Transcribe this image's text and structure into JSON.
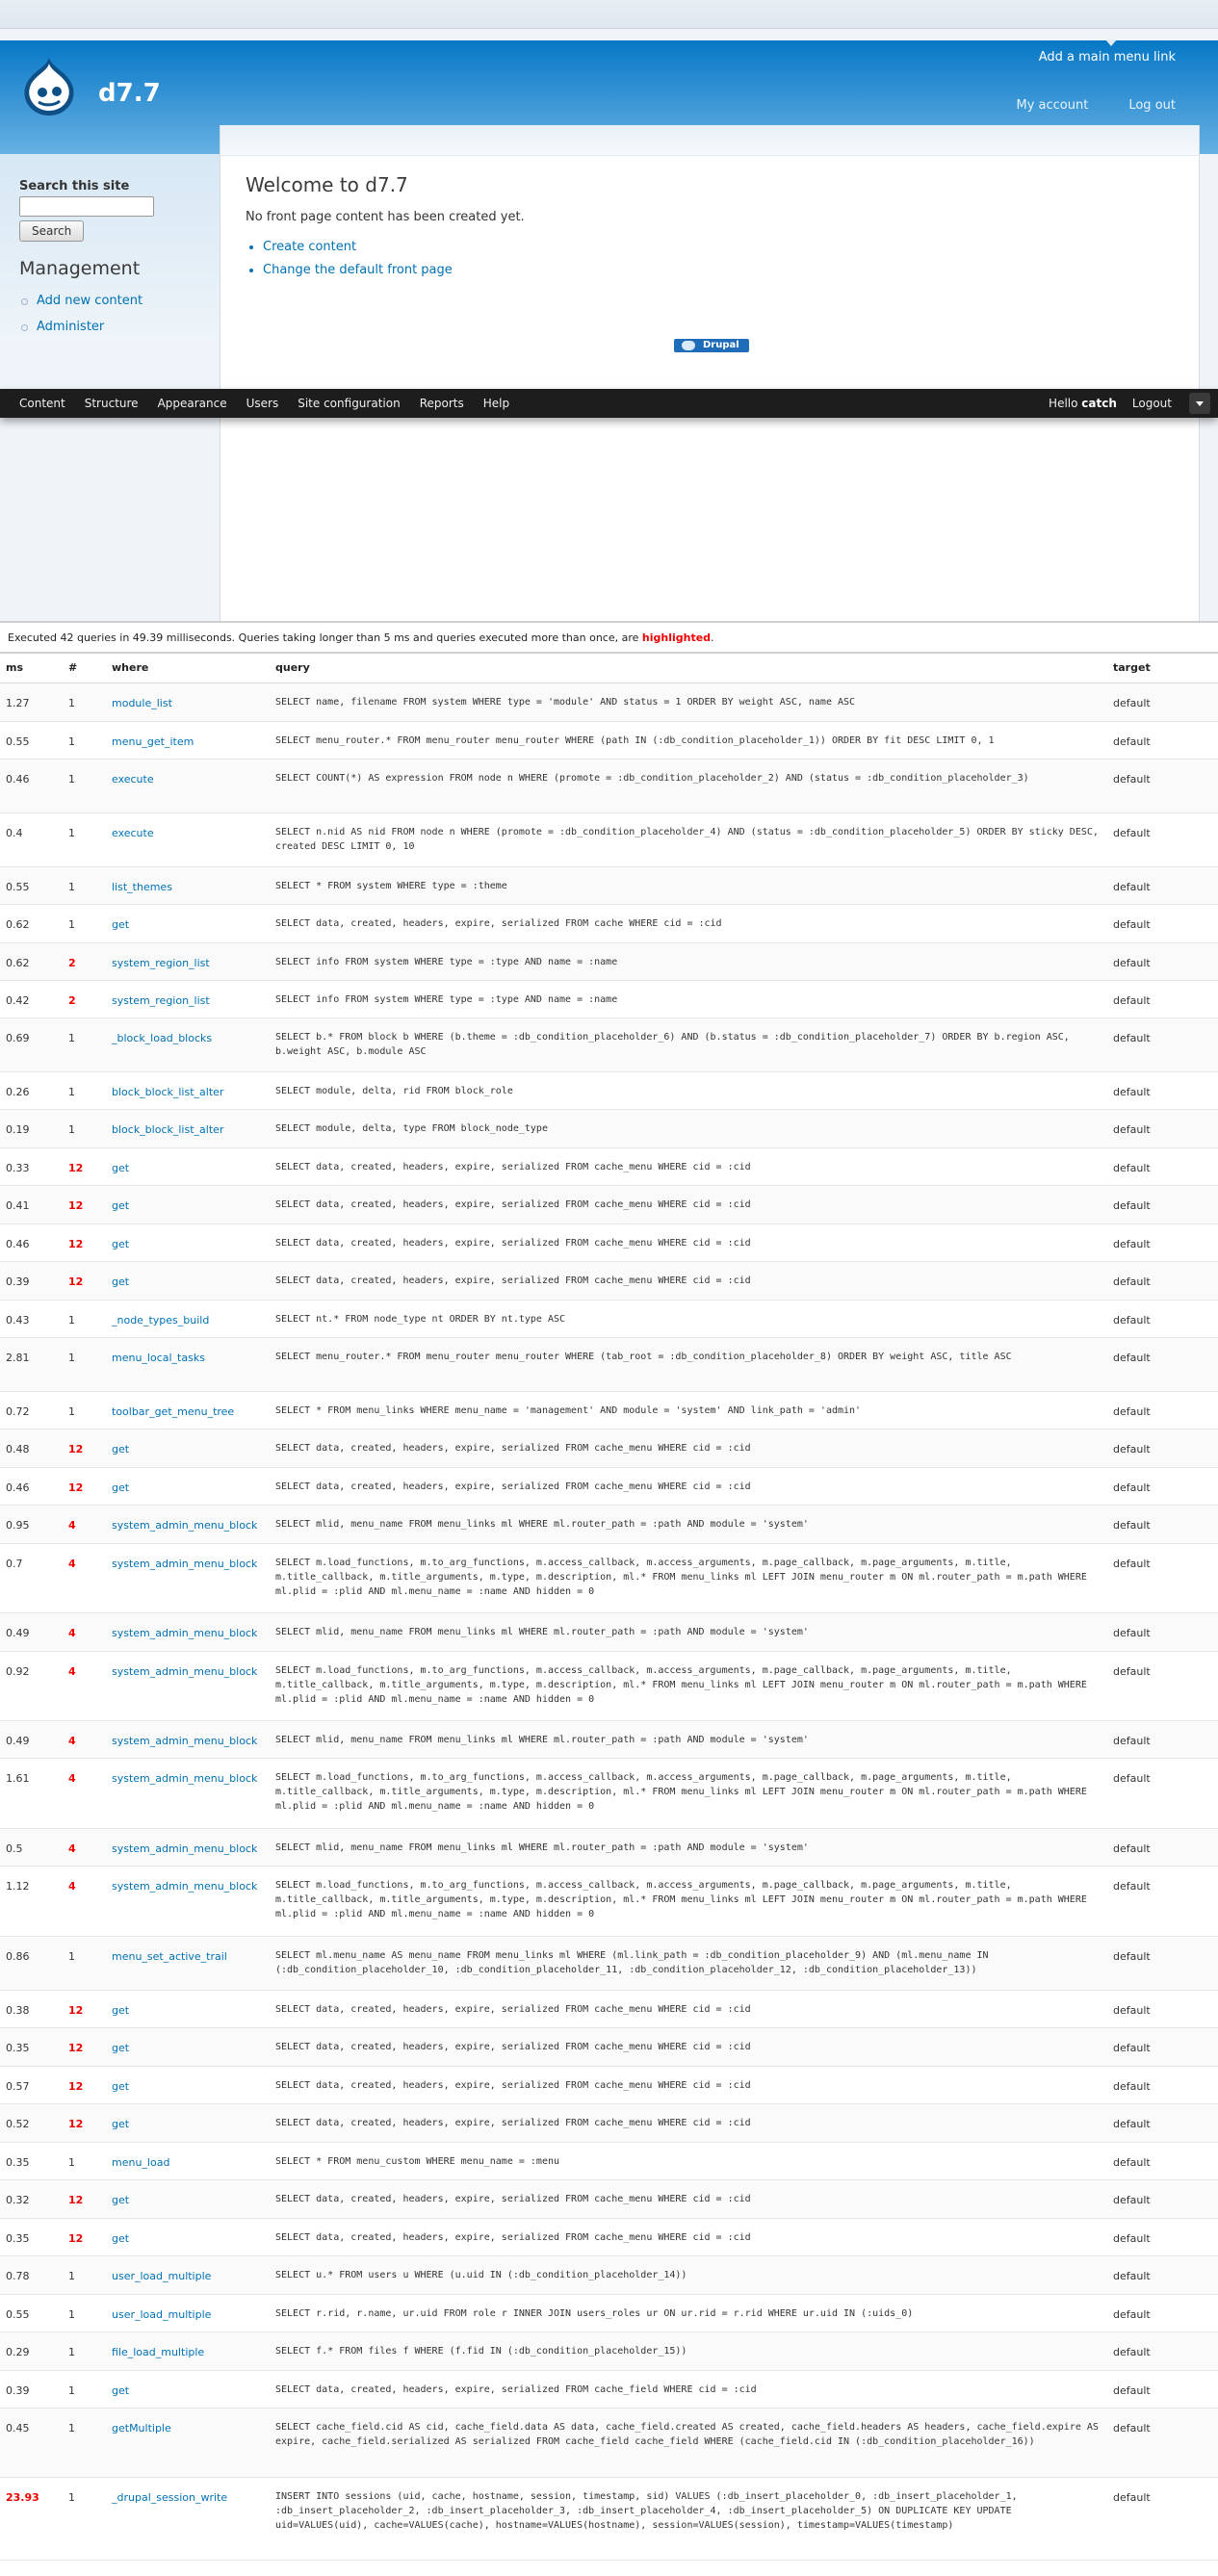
{
  "site": {
    "name": "d7.7",
    "main_menu_link": "Add a main menu link",
    "secondary_menu": [
      "My account",
      "Log out"
    ]
  },
  "sidebar": {
    "search_title": "Search this site",
    "search_value": "",
    "search_button": "Search",
    "management_title": "Management",
    "management_items": [
      "Add new content",
      "Administer"
    ]
  },
  "main": {
    "title": "Welcome to d7.7",
    "message": "No front page content has been created yet.",
    "links": [
      "Create content",
      "Change the default front page"
    ],
    "powered_by": "Drupal"
  },
  "toolbar": {
    "items": [
      "Content",
      "Structure",
      "Appearance",
      "Users",
      "Site configuration",
      "Reports",
      "Help"
    ],
    "hello_prefix": "Hello",
    "user": "catch",
    "logout": "Logout"
  },
  "devel": {
    "summary_prefix": "Executed 42 queries in 49.39 milliseconds. Queries taking longer than 5 ms and queries executed more than once, are",
    "summary_highlight": "highlighted",
    "summary_suffix": ".",
    "columns": [
      "ms",
      "#",
      "where",
      "query",
      "target"
    ],
    "rows": [
      {
        "ms": "1.27",
        "n": "1",
        "where": "module_list",
        "query": "SELECT name, filename FROM system WHERE type = 'module' AND status = 1 ORDER BY weight ASC, name ASC",
        "target": "default",
        "h": 40
      },
      {
        "ms": "0.55",
        "n": "1",
        "where": "menu_get_item",
        "query": "SELECT menu_router.* FROM menu_router menu_router WHERE (path IN (:db_condition_placeholder_1)) ORDER BY fit DESC LIMIT 0, 1",
        "target": "default",
        "h": 39
      },
      {
        "ms": "0.46",
        "n": "1",
        "where": "execute",
        "query": "SELECT COUNT(*) AS expression FROM node n WHERE (promote = :db_condition_placeholder_2) AND (status = :db_condition_placeholder_3)",
        "target": "default",
        "h": 56
      },
      {
        "ms": "0.4",
        "n": "1",
        "where": "execute",
        "query": "SELECT n.nid AS nid FROM node n WHERE (promote = :db_condition_placeholder_4) AND (status = :db_condition_placeholder_5) ORDER BY sticky DESC, created DESC LIMIT 0, 10",
        "target": "default",
        "h": 56
      },
      {
        "ms": "0.55",
        "n": "1",
        "where": "list_themes",
        "query": "SELECT * FROM system WHERE type = :theme",
        "target": "default",
        "h": 39
      },
      {
        "ms": "0.62",
        "n": "1",
        "where": "get",
        "query": "SELECT data, created, headers, expire, serialized FROM cache WHERE cid = :cid",
        "target": "default",
        "h": 40
      },
      {
        "ms": "0.62",
        "n": "2",
        "where": "system_region_list",
        "query": "SELECT info FROM system WHERE type = :type AND name = :name",
        "target": "default",
        "h": 39
      },
      {
        "ms": "0.42",
        "n": "2",
        "where": "system_region_list",
        "query": "SELECT info FROM system WHERE type = :type AND name = :name",
        "target": "default",
        "h": 39
      },
      {
        "ms": "0.69",
        "n": "1",
        "where": "_block_load_blocks",
        "query": "SELECT b.* FROM block b WHERE (b.theme = :db_condition_placeholder_6) AND (b.status = :db_condition_placeholder_7) ORDER BY b.region ASC, b.weight ASC, b.module ASC",
        "target": "default",
        "h": 56
      },
      {
        "ms": "0.26",
        "n": "1",
        "where": "block_block_list_alter",
        "query": "SELECT module, delta, rid FROM block_role",
        "target": "default",
        "h": 39
      },
      {
        "ms": "0.19",
        "n": "1",
        "where": "block_block_list_alter",
        "query": "SELECT module, delta, type FROM block_node_type",
        "target": "default",
        "h": 40
      },
      {
        "ms": "0.33",
        "n": "12",
        "where": "get",
        "query": "SELECT data, created, headers, expire, serialized FROM cache_menu WHERE cid = :cid",
        "target": "default",
        "h": 39
      },
      {
        "ms": "0.41",
        "n": "12",
        "where": "get",
        "query": "SELECT data, created, headers, expire, serialized FROM cache_menu WHERE cid = :cid",
        "target": "default",
        "h": 40
      },
      {
        "ms": "0.46",
        "n": "12",
        "where": "get",
        "query": "SELECT data, created, headers, expire, serialized FROM cache_menu WHERE cid = :cid",
        "target": "default",
        "h": 39
      },
      {
        "ms": "0.39",
        "n": "12",
        "where": "get",
        "query": "SELECT data, created, headers, expire, serialized FROM cache_menu WHERE cid = :cid",
        "target": "default",
        "h": 40
      },
      {
        "ms": "0.43",
        "n": "1",
        "where": "_node_types_build",
        "query": "SELECT nt.* FROM node_type nt ORDER BY nt.type ASC",
        "target": "default",
        "h": 39
      },
      {
        "ms": "2.81",
        "n": "1",
        "where": "menu_local_tasks",
        "query": "SELECT menu_router.* FROM menu_router menu_router WHERE (tab_root = :db_condition_placeholder_8) ORDER BY weight ASC, title ASC",
        "target": "default",
        "h": 56
      },
      {
        "ms": "0.72",
        "n": "1",
        "where": "toolbar_get_menu_tree",
        "query": "SELECT * FROM menu_links WHERE menu_name = 'management' AND module = 'system' AND link_path = 'admin'",
        "target": "default",
        "h": 39
      },
      {
        "ms": "0.48",
        "n": "12",
        "where": "get",
        "query": "SELECT data, created, headers, expire, serialized FROM cache_menu WHERE cid = :cid",
        "target": "default",
        "h": 40
      },
      {
        "ms": "0.46",
        "n": "12",
        "where": "get",
        "query": "SELECT data, created, headers, expire, serialized FROM cache_menu WHERE cid = :cid",
        "target": "default",
        "h": 39
      },
      {
        "ms": "0.95",
        "n": "4",
        "where": "system_admin_menu_block",
        "query": "SELECT mlid, menu_name FROM menu_links ml WHERE ml.router_path = :path AND module = 'system'",
        "target": "default",
        "h": 40
      },
      {
        "ms": "0.7",
        "n": "4",
        "where": "system_admin_menu_block",
        "query": "SELECT m.load_functions, m.to_arg_functions, m.access_callback, m.access_arguments, m.page_callback, m.page_arguments, m.title, m.title_callback, m.title_arguments, m.type, m.description, ml.* FROM menu_links ml LEFT JOIN menu_router m ON ml.router_path = m.path WHERE ml.plid = :plid AND ml.menu_name = :name AND hidden = 0",
        "target": "default",
        "h": 72
      },
      {
        "ms": "0.49",
        "n": "4",
        "where": "system_admin_menu_block",
        "query": "SELECT mlid, menu_name FROM menu_links ml WHERE ml.router_path = :path AND module = 'system'",
        "target": "default",
        "h": 40
      },
      {
        "ms": "0.92",
        "n": "4",
        "where": "system_admin_menu_block",
        "query": "SELECT m.load_functions, m.to_arg_functions, m.access_callback, m.access_arguments, m.page_callback, m.page_arguments, m.title, m.title_callback, m.title_arguments, m.type, m.description, ml.* FROM menu_links ml LEFT JOIN menu_router m ON ml.router_path = m.path WHERE ml.plid = :plid AND ml.menu_name = :name AND hidden = 0",
        "target": "default",
        "h": 72
      },
      {
        "ms": "0.49",
        "n": "4",
        "where": "system_admin_menu_block",
        "query": "SELECT mlid, menu_name FROM menu_links ml WHERE ml.router_path = :path AND module = 'system'",
        "target": "default",
        "h": 39
      },
      {
        "ms": "1.61",
        "n": "4",
        "where": "system_admin_menu_block",
        "query": "SELECT m.load_functions, m.to_arg_functions, m.access_callback, m.access_arguments, m.page_callback, m.page_arguments, m.title, m.title_callback, m.title_arguments, m.type, m.description, ml.* FROM menu_links ml LEFT JOIN menu_router m ON ml.router_path = m.path WHERE ml.plid = :plid AND ml.menu_name = :name AND hidden = 0",
        "target": "default",
        "h": 73
      },
      {
        "ms": "0.5",
        "n": "4",
        "where": "system_admin_menu_block",
        "query": "SELECT mlid, menu_name FROM menu_links ml WHERE ml.router_path = :path AND module = 'system'",
        "target": "default",
        "h": 39
      },
      {
        "ms": "1.12",
        "n": "4",
        "where": "system_admin_menu_block",
        "query": "SELECT m.load_functions, m.to_arg_functions, m.access_callback, m.access_arguments, m.page_callback, m.page_arguments, m.title, m.title_callback, m.title_arguments, m.type, m.description, ml.* FROM menu_links ml LEFT JOIN menu_router m ON ml.router_path = m.path WHERE ml.plid = :plid AND ml.menu_name = :name AND hidden = 0",
        "target": "default",
        "h": 73
      },
      {
        "ms": "0.86",
        "n": "1",
        "where": "menu_set_active_trail",
        "query": "SELECT ml.menu_name AS menu_name FROM menu_links ml WHERE (ml.link_path = :db_condition_placeholder_9) AND (ml.menu_name IN (:db_condition_placeholder_10, :db_condition_placeholder_11, :db_condition_placeholder_12, :db_condition_placeholder_13))",
        "target": "default",
        "h": 56
      },
      {
        "ms": "0.38",
        "n": "12",
        "where": "get",
        "query": "SELECT data, created, headers, expire, serialized FROM cache_menu WHERE cid = :cid",
        "target": "default",
        "h": 39
      },
      {
        "ms": "0.35",
        "n": "12",
        "where": "get",
        "query": "SELECT data, created, headers, expire, serialized FROM cache_menu WHERE cid = :cid",
        "target": "default",
        "h": 40
      },
      {
        "ms": "0.57",
        "n": "12",
        "where": "get",
        "query": "SELECT data, created, headers, expire, serialized FROM cache_menu WHERE cid = :cid",
        "target": "default",
        "h": 39
      },
      {
        "ms": "0.52",
        "n": "12",
        "where": "get",
        "query": "SELECT data, created, headers, expire, serialized FROM cache_menu WHERE cid = :cid",
        "target": "default",
        "h": 40
      },
      {
        "ms": "0.35",
        "n": "1",
        "where": "menu_load",
        "query": "SELECT * FROM menu_custom WHERE menu_name = :menu",
        "target": "default",
        "h": 39
      },
      {
        "ms": "0.32",
        "n": "12",
        "where": "get",
        "query": "SELECT data, created, headers, expire, serialized FROM cache_menu WHERE cid = :cid",
        "target": "default",
        "h": 40
      },
      {
        "ms": "0.35",
        "n": "12",
        "where": "get",
        "query": "SELECT data, created, headers, expire, serialized FROM cache_menu WHERE cid = :cid",
        "target": "default",
        "h": 39
      },
      {
        "ms": "0.78",
        "n": "1",
        "where": "user_load_multiple",
        "query": "SELECT u.* FROM users u WHERE (u.uid IN (:db_condition_placeholder_14))",
        "target": "default",
        "h": 40
      },
      {
        "ms": "0.55",
        "n": "1",
        "where": "user_load_multiple",
        "query": "SELECT r.rid, r.name, ur.uid FROM role r INNER JOIN users_roles ur ON ur.rid = r.rid WHERE ur.uid IN (:uids_0)",
        "target": "default",
        "h": 39
      },
      {
        "ms": "0.29",
        "n": "1",
        "where": "file_load_multiple",
        "query": "SELECT f.* FROM files f WHERE (f.fid IN (:db_condition_placeholder_15))",
        "target": "default",
        "h": 40
      },
      {
        "ms": "0.39",
        "n": "1",
        "where": "get",
        "query": "SELECT data, created, headers, expire, serialized FROM cache_field WHERE cid = :cid",
        "target": "default",
        "h": 39
      },
      {
        "ms": "0.45",
        "n": "1",
        "where": "getMultiple",
        "query": "SELECT cache_field.cid AS cid, cache_field.data AS data, cache_field.created AS created, cache_field.headers AS headers, cache_field.expire AS expire, cache_field.serialized AS serialized FROM cache_field cache_field WHERE (cache_field.cid IN (:db_condition_placeholder_16))",
        "target": "default",
        "h": 72
      },
      {
        "ms": "23.93",
        "n": "1",
        "where": "_drupal_session_write",
        "query": "INSERT INTO sessions (uid, cache, hostname, session, timestamp, sid) VALUES (:db_insert_placeholder_0, :db_insert_placeholder_1, :db_insert_placeholder_2, :db_insert_placeholder_3, :db_insert_placeholder_4, :db_insert_placeholder_5) ON DUPLICATE KEY UPDATE uid=VALUES(uid), cache=VALUES(cache), hostname=VALUES(hostname), session=VALUES(session), timestamp=VALUES(timestamp)",
        "target": "default",
        "h": 86
      }
    ]
  }
}
